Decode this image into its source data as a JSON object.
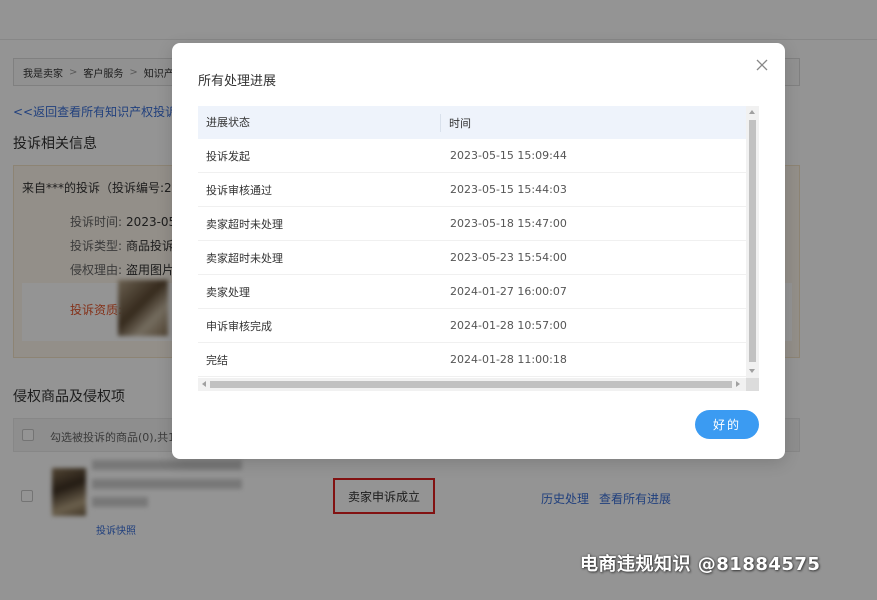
{
  "background": {
    "breadcrumb": [
      "我是卖家",
      "客户服务",
      "知识产权"
    ],
    "back_link": "<<返回查看所有知识产权投诉",
    "section_complaint": "投诉相关信息",
    "complaint_header": "来自***的投诉（投诉编号:2023",
    "info_rows": [
      {
        "label": "投诉时间:",
        "value": "2023-05-"
      },
      {
        "label": "投诉类型:",
        "value": "商品投诉"
      },
      {
        "label": "侵权理由:",
        "value": "盗用图片"
      }
    ],
    "qualification_label": "投诉资质:",
    "section_goods": "侵权商品及侵权项",
    "goods_head": "勾选被投诉的商品(0),共1个",
    "snapshot_link": "投诉快照",
    "status": "卖家申诉成立",
    "history_link": "历史处理",
    "all_progress_link": "查看所有进展",
    "watermark": "电商违规知识 @81884575"
  },
  "modal": {
    "title": "所有处理进展",
    "columns": [
      "进展状态",
      "时间"
    ],
    "rows": [
      {
        "status": "投诉发起",
        "time": "2023-05-15 15:09:44"
      },
      {
        "status": "投诉审核通过",
        "time": "2023-05-15 15:44:03"
      },
      {
        "status": "卖家超时未处理",
        "time": "2023-05-18 15:47:00"
      },
      {
        "status": "卖家超时未处理",
        "time": "2023-05-23 15:54:00"
      },
      {
        "status": "卖家处理",
        "time": "2024-01-27 16:00:07"
      },
      {
        "status": "申诉审核完成",
        "time": "2024-01-28 10:57:00"
      },
      {
        "status": "完结",
        "time": "2024-01-28 11:00:18"
      }
    ],
    "ok_label": "好的"
  },
  "colors": {
    "accent": "#3b9bf2",
    "link": "#3a6fd8",
    "highlight_border": "#e02020",
    "warning_bg": "#fdf6ec",
    "table_head_bg": "#eef3fb"
  },
  "icons": {
    "close": "close-icon"
  }
}
